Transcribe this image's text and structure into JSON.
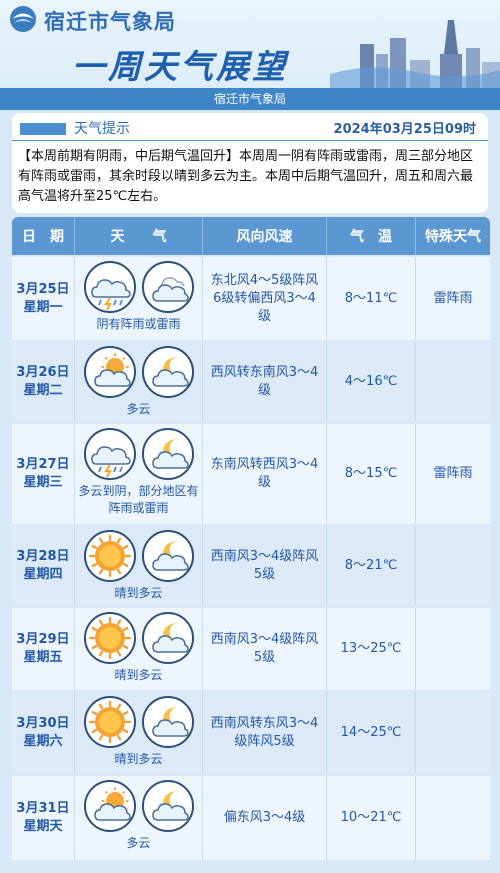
{
  "header": {
    "agency": "宿迁市气象局",
    "title": "一周天气展望",
    "subtitle": "宿迁市气象局"
  },
  "notice": {
    "label": "天气提示",
    "date": "2024年03月25日09时",
    "text": "【本周前期有阴雨，中后期气温回升】本周周一阴有阵雨或雷雨，周三部分地区有阵雨或雷雨，其余时段以晴到多云为主。本周中后期气温回升，周五和周六最高气温将升至25℃左右。"
  },
  "table": {
    "headers": [
      "日　期",
      "天　　气",
      "风向风速",
      "气　温",
      "特殊天气"
    ],
    "rows": [
      {
        "date": "3月25日",
        "weekday": "星期一",
        "icons": [
          "cloud-thunder-rain-icon",
          "overcast-cloud-icon"
        ],
        "weather": "阴有阵雨或雷雨",
        "wind": "东北风4～5级阵风6级转偏西风3～4级",
        "temp": "8～11℃",
        "special": "雷阵雨"
      },
      {
        "date": "3月26日",
        "weekday": "星期二",
        "icons": [
          "sun-behind-cloud-icon",
          "moon-behind-cloud-icon"
        ],
        "weather": "多云",
        "wind": "西风转东南风3～4级",
        "temp": "4～16℃",
        "special": ""
      },
      {
        "date": "3月27日",
        "weekday": "星期三",
        "icons": [
          "cloud-thunder-rain-icon",
          "moon-behind-cloud-icon"
        ],
        "weather": "多云到阴，部分地区有阵雨或雷雨",
        "wind": "东南风转西风3～4级",
        "temp": "8～15℃",
        "special": "雷阵雨"
      },
      {
        "date": "3月28日",
        "weekday": "星期四",
        "icons": [
          "sun-icon",
          "moon-behind-cloud-icon"
        ],
        "weather": "晴到多云",
        "wind": "西南风3～4级阵风5级",
        "temp": "8～21℃",
        "special": ""
      },
      {
        "date": "3月29日",
        "weekday": "星期五",
        "icons": [
          "sun-icon",
          "moon-behind-cloud-icon"
        ],
        "weather": "晴到多云",
        "wind": "西南风3～4级阵风5级",
        "temp": "13～25℃",
        "special": ""
      },
      {
        "date": "3月30日",
        "weekday": "星期六",
        "icons": [
          "sun-icon",
          "moon-behind-cloud-icon"
        ],
        "weather": "晴到多云",
        "wind": "西南风转东风3～4级阵风5级",
        "temp": "14～25℃",
        "special": ""
      },
      {
        "date": "3月31日",
        "weekday": "星期天",
        "icons": [
          "sun-behind-cloud-icon",
          "moon-behind-cloud-icon"
        ],
        "weather": "多云",
        "wind": "偏东风3～4级",
        "temp": "10～21℃",
        "special": ""
      }
    ]
  },
  "colors": {
    "accent": "#3f86c8",
    "header_row": "#5b97d0",
    "text_blue": "#2158a8",
    "background": "#d8e8f6"
  }
}
